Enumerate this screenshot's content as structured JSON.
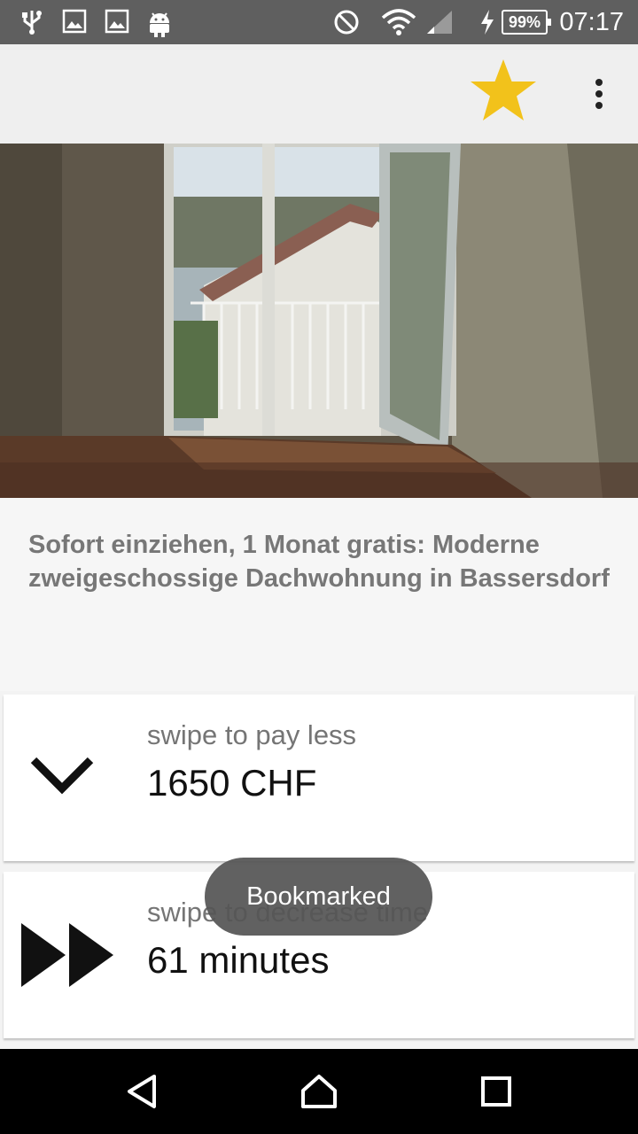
{
  "status_bar": {
    "battery": "99%",
    "time": "07:17",
    "icons": [
      "usb-icon",
      "image-icon",
      "image-icon",
      "android-icon",
      "do-not-disturb-icon",
      "wifi-icon",
      "signal-icon",
      "charging-icon"
    ]
  },
  "app_bar": {
    "bookmark_icon": "star-icon",
    "bookmark_color": "#f2c21b",
    "menu_icon": "more-vert-icon"
  },
  "listing": {
    "title": "Sofort einziehen, 1 Monat gratis: Moderne zweigeschossige Dachwohnung in Bassersdorf"
  },
  "price": {
    "hint": "swipe to pay less",
    "value": "1650 CHF",
    "icon": "chevron-down-icon"
  },
  "commute": {
    "hint": "swipe to decrease time",
    "value": "61 minutes",
    "icon": "fast-forward-icon"
  },
  "toast": {
    "text": "Bookmarked"
  },
  "nav_bar": {
    "icons": [
      "back-icon",
      "home-icon",
      "recents-icon"
    ]
  }
}
